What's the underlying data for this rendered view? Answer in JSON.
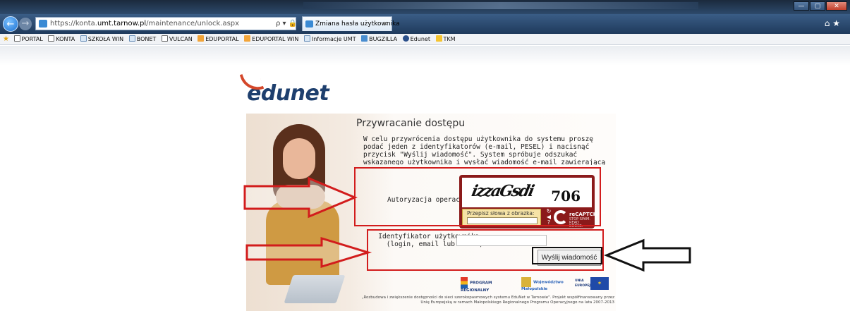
{
  "browser": {
    "url_prefix": "https://konta.",
    "url_host": "umt.tarnow.pl",
    "url_path": "/maintenance/unlock.aspx",
    "address_tools": "ρ ▾ 🔒 ≣ C ✕",
    "tab_title": "Zmiana hasła użytkownika",
    "tab_close": "×",
    "right_icons": "⌂ ★",
    "window_buttons": [
      "—",
      "▢",
      "✕"
    ]
  },
  "favorites": [
    {
      "label": "PORTAL",
      "icon": "v-icon"
    },
    {
      "label": "KONTA",
      "icon": "v-icon"
    },
    {
      "label": "SZKOŁA WIN",
      "icon": "page-icon"
    },
    {
      "label": "BONET",
      "icon": "page-icon"
    },
    {
      "label": "VULCAN",
      "icon": "v-icon"
    },
    {
      "label": "EDUPORTAL",
      "icon": "folder-icon"
    },
    {
      "label": "EDUPORTAL WIN",
      "icon": "folder-icon"
    },
    {
      "label": "Informacje UMT",
      "icon": "page-icon"
    },
    {
      "label": "BUGZILLA",
      "icon": "bug-icon"
    },
    {
      "label": "Edunet",
      "icon": "edunet-icon"
    },
    {
      "label": "TKM",
      "icon": "folder-icon"
    }
  ],
  "page": {
    "logo_text": "edunet",
    "title": "Przywracanie dostępu",
    "description": "W celu przywrócenia dostępu użytkownika do systemu proszę podać jeden z identyfikatorów (e-mail, PESEL) i nacisnąć przycisk \"Wyślij wiadomość\". System spróbuje odszukać wskazanego użytkownika i wysłać wiadomość e-mail zawierającą szczegółowe informacje.",
    "captcha_label": "Autoryzacja operacji:",
    "captcha_word": "izzaGsdi",
    "captcha_number": "706",
    "captcha_prompt": "Przepisz słowa z obrazka:",
    "captcha_brand": "reCAPTCHA™",
    "captcha_tagline": "STOP SPAM. READ BOOKS.",
    "id_label_line1": "Identyfikator użytkownika:",
    "id_label_line2": "(login, email lub PESEL)",
    "send_button": "Wyślij wiadomość",
    "sponsor_logos": [
      "PROGRAM REGIONALNY",
      "Województwo Małopolskie",
      "UNIA EUROPEJSKA"
    ],
    "footer": "„Rozbudowa i zwiększenie dostępności do sieci szerokopasmowych systemu EduNet w Tarnowie\". Projekt współfinansowany przez Unię Europejską w ramach Małopolskiego Regionalnego Programu Operacyjnego na lata 2007-2013"
  },
  "annotations": {
    "highlight_color": "#d21c1c",
    "arrow_color": "#d21c1c",
    "button_highlight_color": "#111111"
  }
}
